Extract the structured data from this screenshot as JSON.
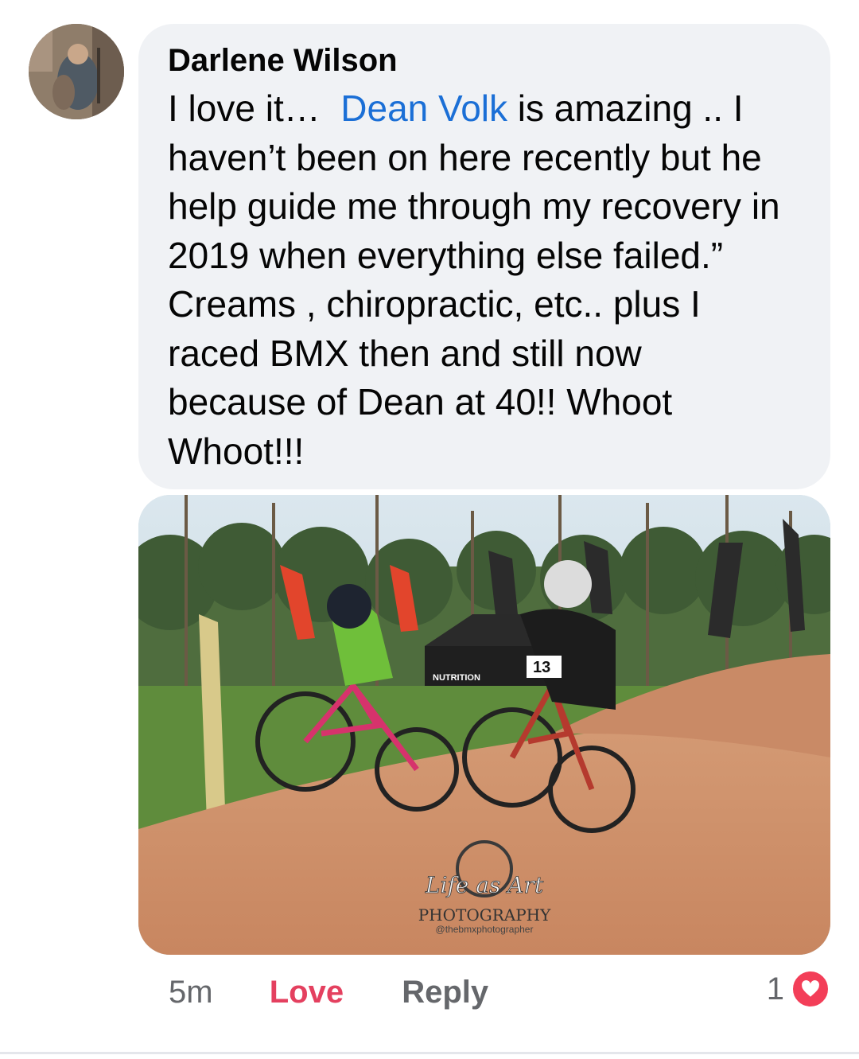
{
  "comment": {
    "author": "Darlene Wilson",
    "text_before": "I love it…  ",
    "mention": "Dean Volk",
    "text_after": " is amazing .. I\nhaven’t been on here recently but he\nhelp guide me through my recovery in\n2019 when everything else failed.”\nCreams , chiropractic, etc.. plus I\nraced BMX then and still now\nbecause of Dean at 40!! Whoot\nWhoot!!!"
  },
  "photo": {
    "watermark_script": "Life as Art",
    "watermark_title": "PHOTOGRAPHY",
    "watermark_handle": "@thebmxphotographer",
    "banner_text": "NUTRITION",
    "plate_number": "13"
  },
  "actions": {
    "timestamp": "5m",
    "love_label": "Love",
    "reply_label": "Reply",
    "reaction_count": "1"
  },
  "colors": {
    "bubble_bg": "#f0f2f5",
    "mention": "#1b6fd6",
    "love": "#e4405f",
    "muted": "#65676b",
    "heart": "#f33e58"
  }
}
